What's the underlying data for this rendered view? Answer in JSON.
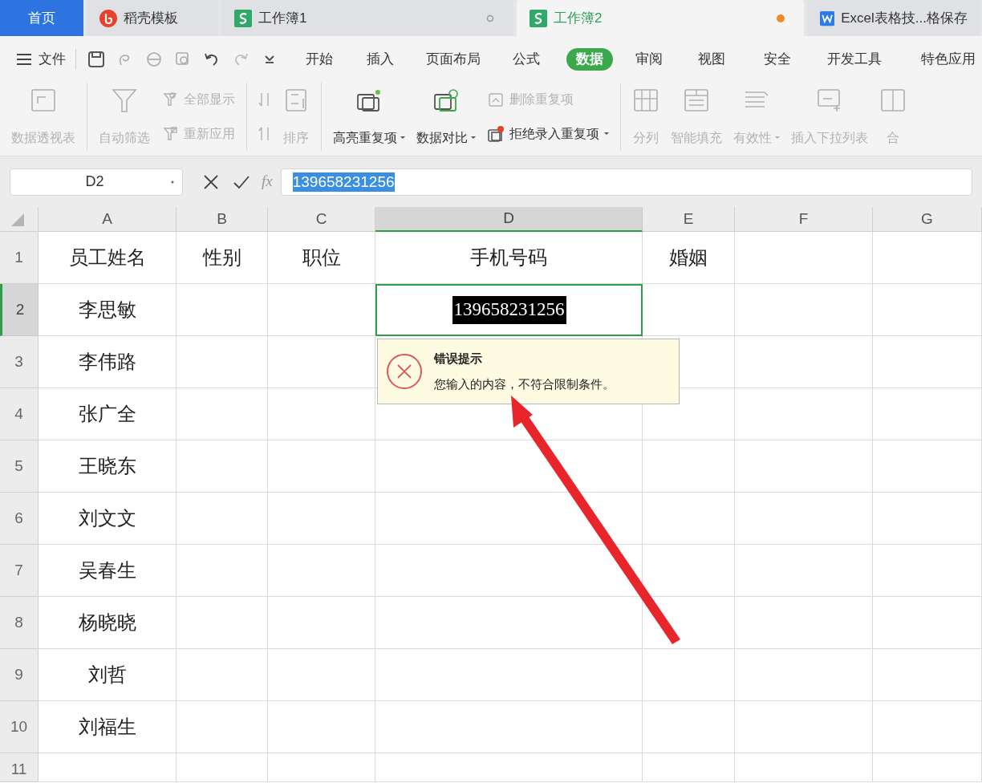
{
  "tabs": [
    {
      "kind": "home",
      "label": "首页",
      "selected": false
    },
    {
      "kind": "docer",
      "label": "稻壳模板",
      "selected": false
    },
    {
      "kind": "sheet",
      "label": "工作簿1",
      "selected": false,
      "modified": false
    },
    {
      "kind": "sheet",
      "label": "工作簿2",
      "selected": true,
      "modified": true
    },
    {
      "kind": "word",
      "label": "Excel表格技...格保存",
      "selected": false
    }
  ],
  "menu": {
    "file": "文件",
    "items": [
      {
        "label": "开始",
        "selected": false
      },
      {
        "label": "插入",
        "selected": false
      },
      {
        "label": "页面布局",
        "selected": false
      },
      {
        "label": "公式",
        "selected": false
      },
      {
        "label": "数据",
        "selected": true
      },
      {
        "label": "审阅",
        "selected": false
      },
      {
        "label": "视图",
        "selected": false
      },
      {
        "label": "安全",
        "selected": false
      },
      {
        "label": "开发工具",
        "selected": false
      },
      {
        "label": "特色应用",
        "selected": false
      }
    ]
  },
  "ribbon": {
    "groups": [
      {
        "items": [
          {
            "kind": "large",
            "label": "数据透视表",
            "disabled": true,
            "dropdown": false
          }
        ]
      },
      {
        "items": [
          {
            "kind": "large",
            "label": "自动筛选",
            "disabled": true,
            "dropdown": false
          },
          {
            "kind": "small",
            "label": "全部显示",
            "disabled": true,
            "dropdown": false
          },
          {
            "kind": "small",
            "label": "重新应用",
            "disabled": true,
            "dropdown": false
          }
        ]
      },
      {
        "items": [
          {
            "kind": "iconpair",
            "disabled": true
          },
          {
            "kind": "large",
            "label": "排序",
            "disabled": true,
            "dropdown": false
          }
        ]
      },
      {
        "items": [
          {
            "kind": "large",
            "label": "高亮重复项",
            "disabled": false,
            "dropdown": true
          },
          {
            "kind": "large",
            "label": "数据对比",
            "disabled": false,
            "dropdown": true
          },
          {
            "kind": "small",
            "label": "删除重复项",
            "disabled": true,
            "dropdown": false
          },
          {
            "kind": "small",
            "label": "拒绝录入重复项",
            "disabled": false,
            "dropdown": true
          }
        ]
      },
      {
        "items": [
          {
            "kind": "large",
            "label": "分列",
            "disabled": true,
            "dropdown": false
          },
          {
            "kind": "large",
            "label": "智能填充",
            "disabled": true,
            "dropdown": false
          },
          {
            "kind": "large",
            "label": "有效性",
            "disabled": true,
            "dropdown": true
          },
          {
            "kind": "large",
            "label": "插入下拉列表",
            "disabled": true,
            "dropdown": false
          },
          {
            "kind": "large",
            "label": "合",
            "disabled": true,
            "dropdown": false
          }
        ]
      }
    ]
  },
  "formula_bar": {
    "name_box": "D2",
    "fx": "fx",
    "value": "139658231256"
  },
  "sheet": {
    "columns": [
      {
        "label": "A",
        "selected": false
      },
      {
        "label": "B",
        "selected": false
      },
      {
        "label": "C",
        "selected": false
      },
      {
        "label": "D",
        "selected": true
      },
      {
        "label": "E",
        "selected": false
      },
      {
        "label": "F",
        "selected": false
      },
      {
        "label": "G",
        "selected": false
      }
    ],
    "rows": [
      {
        "number": "1",
        "selected": false,
        "cells": {
          "A": "员工姓名",
          "B": "性别",
          "C": "职位",
          "D": "手机号码",
          "E": "婚姻"
        }
      },
      {
        "number": "2",
        "selected": true,
        "cells": {
          "A": "李思敏",
          "D": "139658231256"
        }
      },
      {
        "number": "3",
        "selected": false,
        "cells": {
          "A": "李伟路"
        }
      },
      {
        "number": "4",
        "selected": false,
        "cells": {
          "A": "张广全"
        }
      },
      {
        "number": "5",
        "selected": false,
        "cells": {
          "A": "王晓东"
        }
      },
      {
        "number": "6",
        "selected": false,
        "cells": {
          "A": "刘文文"
        }
      },
      {
        "number": "7",
        "selected": false,
        "cells": {
          "A": "吴春生"
        }
      },
      {
        "number": "8",
        "selected": false,
        "cells": {
          "A": "杨晓晓"
        }
      },
      {
        "number": "9",
        "selected": false,
        "cells": {
          "A": "刘哲"
        }
      },
      {
        "number": "10",
        "selected": false,
        "cells": {
          "A": "刘福生"
        }
      },
      {
        "number": "11",
        "selected": false,
        "cells": {}
      }
    ]
  },
  "error_tip": {
    "title": "错误提示",
    "message": "您输入的内容，不符合限制条件。"
  }
}
